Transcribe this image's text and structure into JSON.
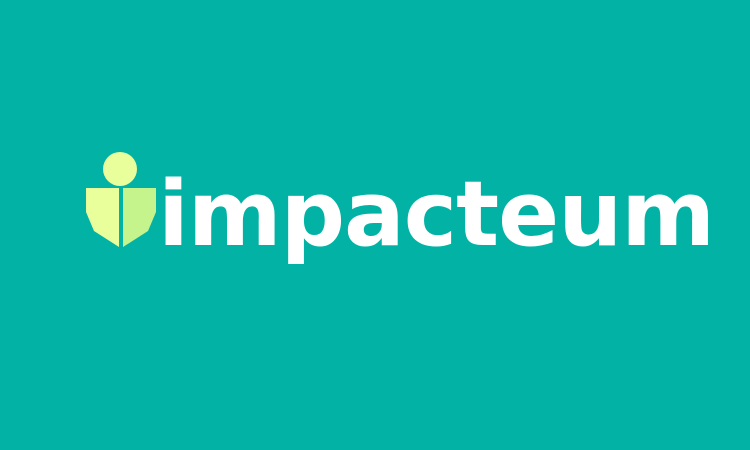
{
  "brand": {
    "name": "impacteum",
    "background_color": "#02b3a5",
    "text_color": "#ffffff",
    "mark_light_color": "#e9ff9b",
    "mark_green_color": "#c6f48c",
    "mark_icon": "person-shield-icon"
  }
}
